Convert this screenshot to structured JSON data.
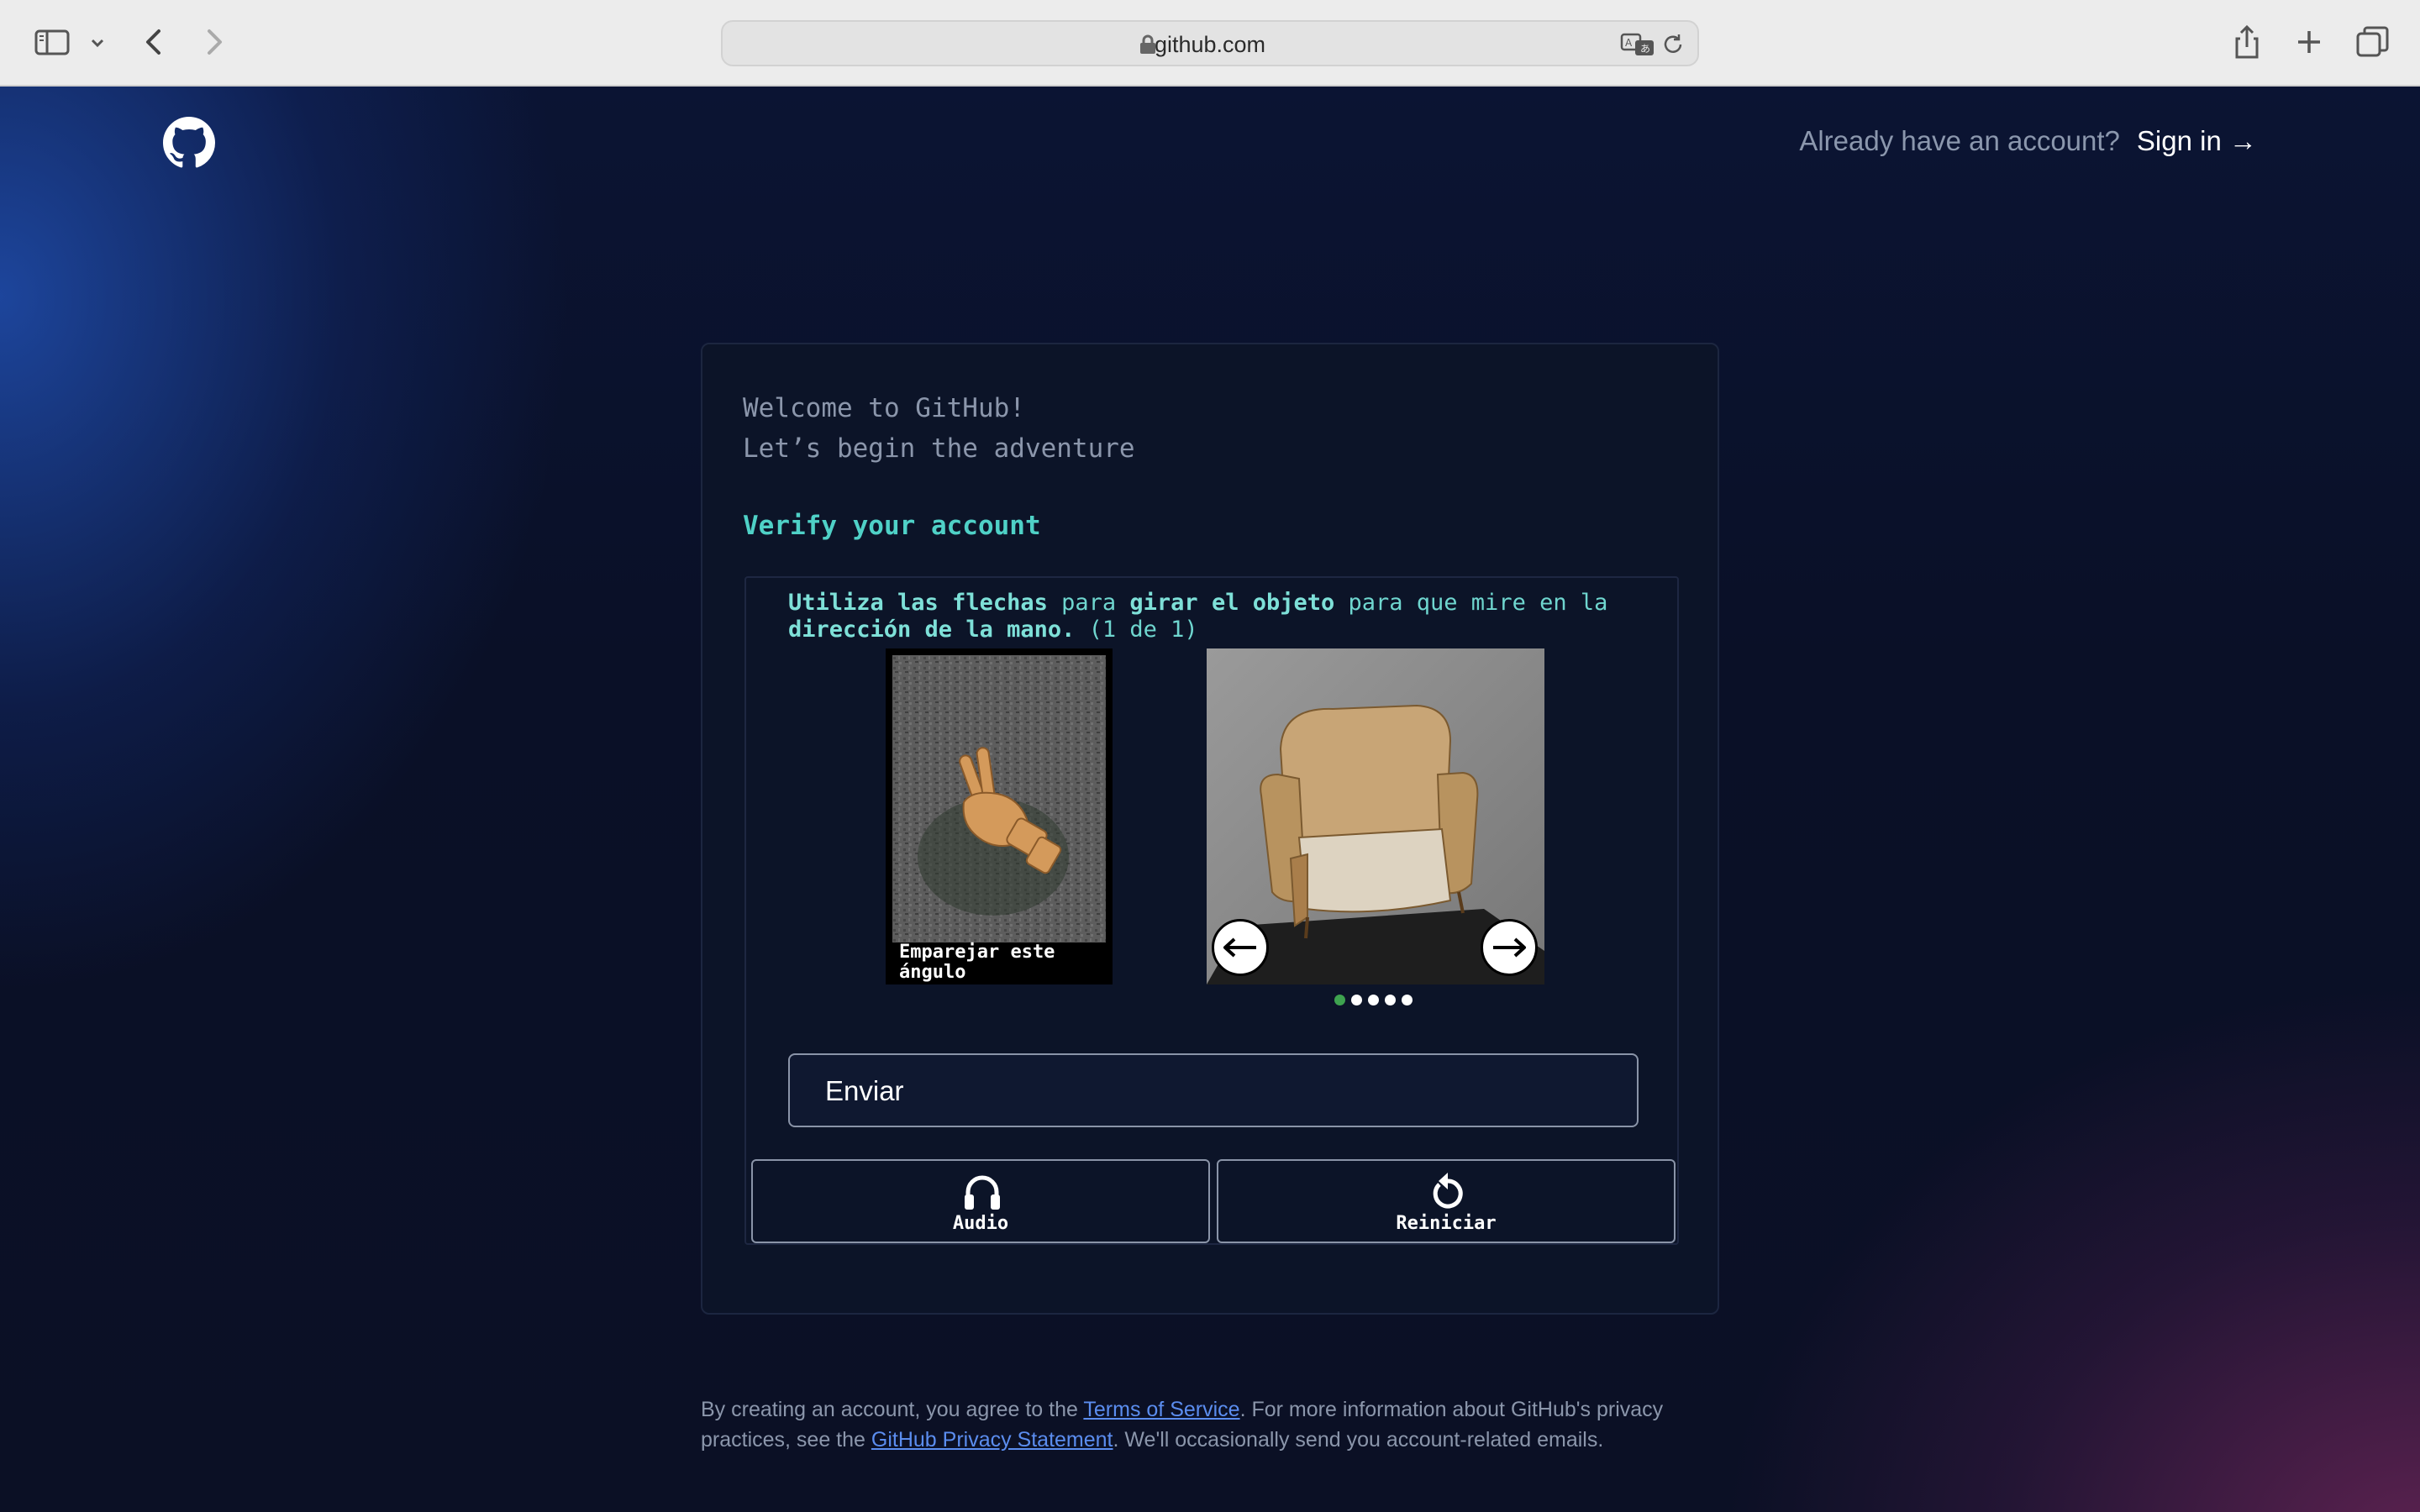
{
  "browser": {
    "url": "github.com",
    "icons": [
      "sidebar-icon",
      "chevron-down-icon",
      "back-icon",
      "forward-icon",
      "lock-icon",
      "translate-icon",
      "reload-icon",
      "share-icon",
      "new-tab-icon",
      "tabs-overview-icon"
    ]
  },
  "header": {
    "logo": "github-mark-icon",
    "prompt": "Already have an account?",
    "signin_label": "Sign in →"
  },
  "card": {
    "welcome_line1": "Welcome to GitHub!",
    "welcome_line2": "Let’s begin the adventure",
    "verify_title": "Verify your account"
  },
  "captcha": {
    "instr_1": "Utiliza las flechas",
    "instr_2": " para ",
    "instr_3": "girar el objeto",
    "instr_4": " para que mire en la ",
    "instr_5": "dirección de la mano.",
    "instr_6": " (1 de 1)",
    "reference_caption": "Emparejar este ángulo",
    "reference_image": "wooden-hand-pointing-icon",
    "object_image": "armchair-icon",
    "left_arrow": "arrow-left-icon",
    "right_arrow": "arrow-right-icon",
    "dots_total": 5,
    "dots_active_index": 0,
    "submit_label": "Enviar",
    "audio_label": "Audio",
    "reset_label": "Reiniciar",
    "colors": {
      "accent": "#4fd1c7",
      "active_dot": "#3ea34f"
    }
  },
  "legal": {
    "text_1": "By creating an account, you agree to the ",
    "terms_link": "Terms of Service",
    "text_2": ". For more information about GitHub's privacy practices, see the ",
    "privacy_link": "GitHub Privacy Statement",
    "text_3": ". We'll occasionally send you account-related emails.",
    "link_color": "#5b8def"
  }
}
